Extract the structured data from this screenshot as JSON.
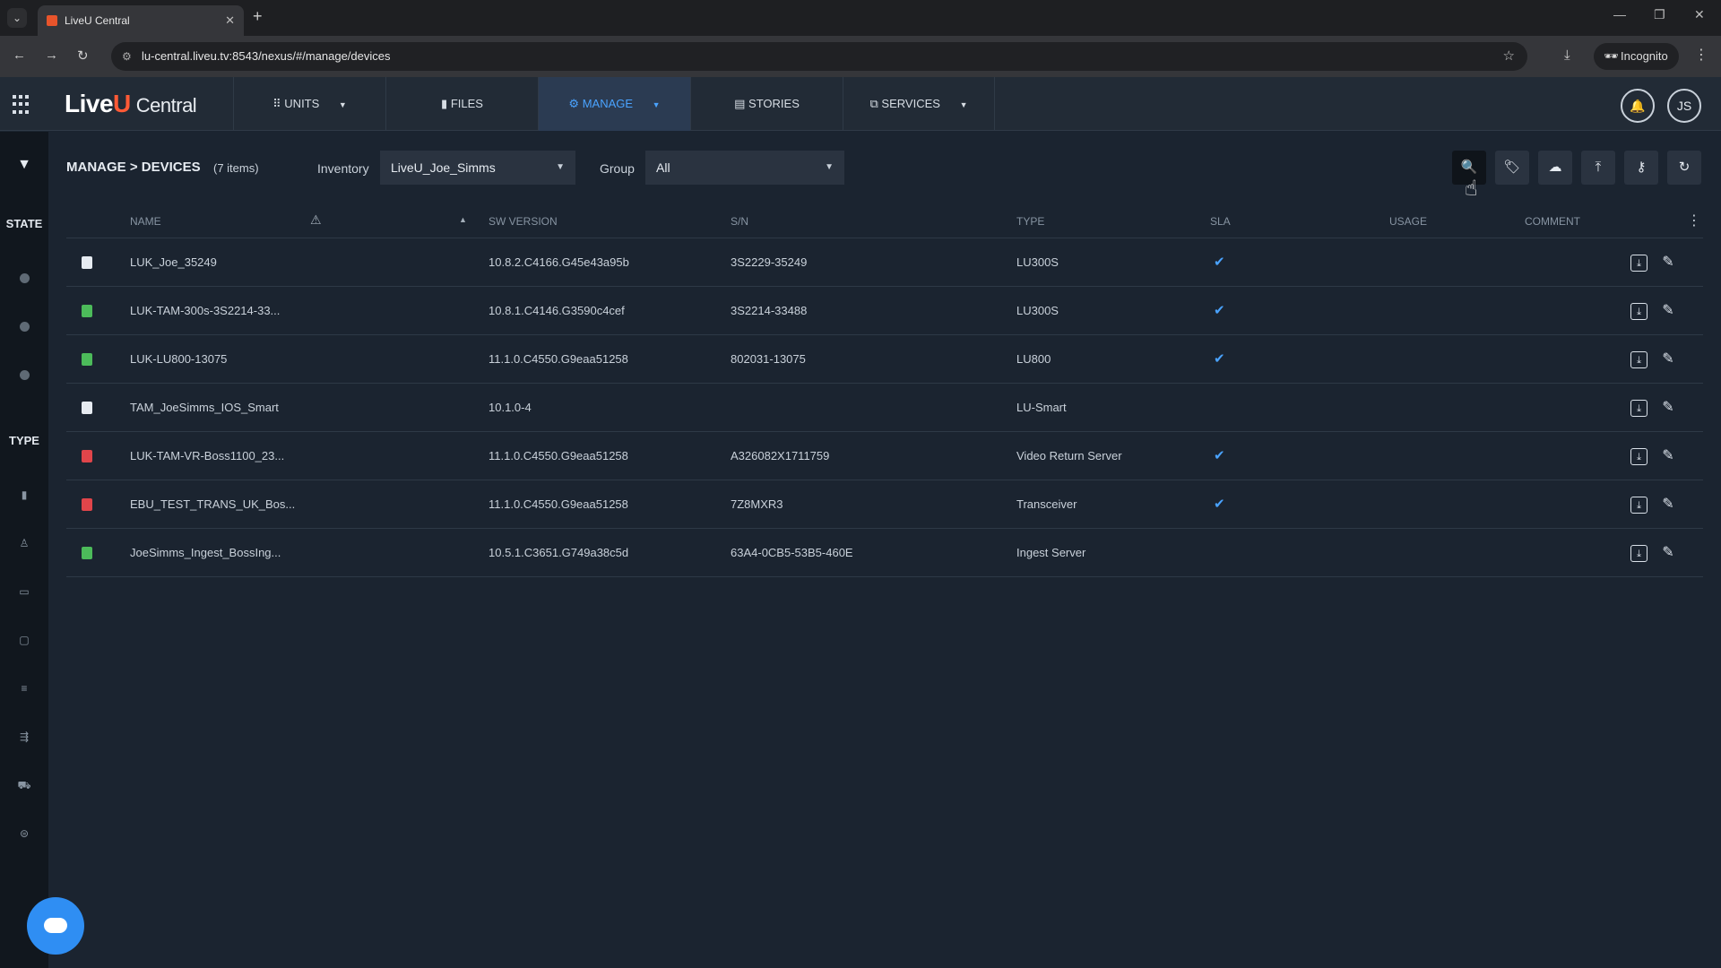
{
  "browser": {
    "tab_title": "LiveU Central",
    "url": "lu-central.liveu.tv:8543/nexus/#/manage/devices",
    "incognito_label": "Incognito"
  },
  "header": {
    "logo_live": "Live",
    "logo_u": "U",
    "logo_central": "Central",
    "tabs": [
      {
        "label": "UNITS",
        "icon": "grid-icon"
      },
      {
        "label": "FILES",
        "icon": "file-icon"
      },
      {
        "label": "MANAGE",
        "icon": "gear-icon"
      },
      {
        "label": "STORIES",
        "icon": "list-icon"
      },
      {
        "label": "SERVICES",
        "icon": "services-icon"
      }
    ],
    "user_initials": "JS"
  },
  "rail": {
    "state_label": "STATE",
    "type_label": "TYPE"
  },
  "toolbar": {
    "title": "MANAGE > DEVICES",
    "count": "(7 items)",
    "inventory_label": "Inventory",
    "inventory_value": "LiveU_Joe_Simms",
    "group_label": "Group",
    "group_value": "All"
  },
  "table": {
    "columns": {
      "name": "NAME",
      "sw_version": "SW VERSION",
      "sn": "S/N",
      "type": "TYPE",
      "sla": "SLA",
      "usage": "USAGE",
      "comment": "COMMENT"
    },
    "rows": [
      {
        "name": "LUK_Joe_35249",
        "sw": "10.8.2.C4166.G45e43a95b",
        "sn": "3S2229-35249",
        "type": "LU300S",
        "sla": "✔",
        "icon_color": "#e6ebf1"
      },
      {
        "name": "LUK-TAM-300s-3S2214-33...",
        "sw": "10.8.1.C4146.G3590c4cef",
        "sn": "3S2214-33488",
        "type": "LU300S",
        "sla": "✔",
        "icon_color": "#4cbb5a"
      },
      {
        "name": "LUK-LU800-13075",
        "sw": "11.1.0.C4550.G9eaa51258",
        "sn": "802031-13075",
        "type": "LU800",
        "sla": "✔",
        "icon_color": "#4cbb5a"
      },
      {
        "name": "TAM_JoeSimms_IOS_Smart",
        "sw": "10.1.0-4",
        "sn": "",
        "type": "LU-Smart",
        "sla": "",
        "icon_color": "#e6ebf1"
      },
      {
        "name": "LUK-TAM-VR-Boss1100_23...",
        "sw": "11.1.0.C4550.G9eaa51258",
        "sn": "A326082X1711759",
        "type": "Video Return Server",
        "sla": "✔",
        "icon_color": "#e0454a"
      },
      {
        "name": "EBU_TEST_TRANS_UK_Bos...",
        "sw": "11.1.0.C4550.G9eaa51258",
        "sn": "7Z8MXR3",
        "type": "Transceiver",
        "sla": "✔",
        "icon_color": "#e0454a"
      },
      {
        "name": "JoeSimms_Ingest_BossIng...",
        "sw": "10.5.1.C3651.G749a38c5d",
        "sn": "63A4-0CB5-53B5-460E",
        "type": "Ingest Server",
        "sla": "",
        "icon_color": "#4cbb5a"
      }
    ]
  }
}
